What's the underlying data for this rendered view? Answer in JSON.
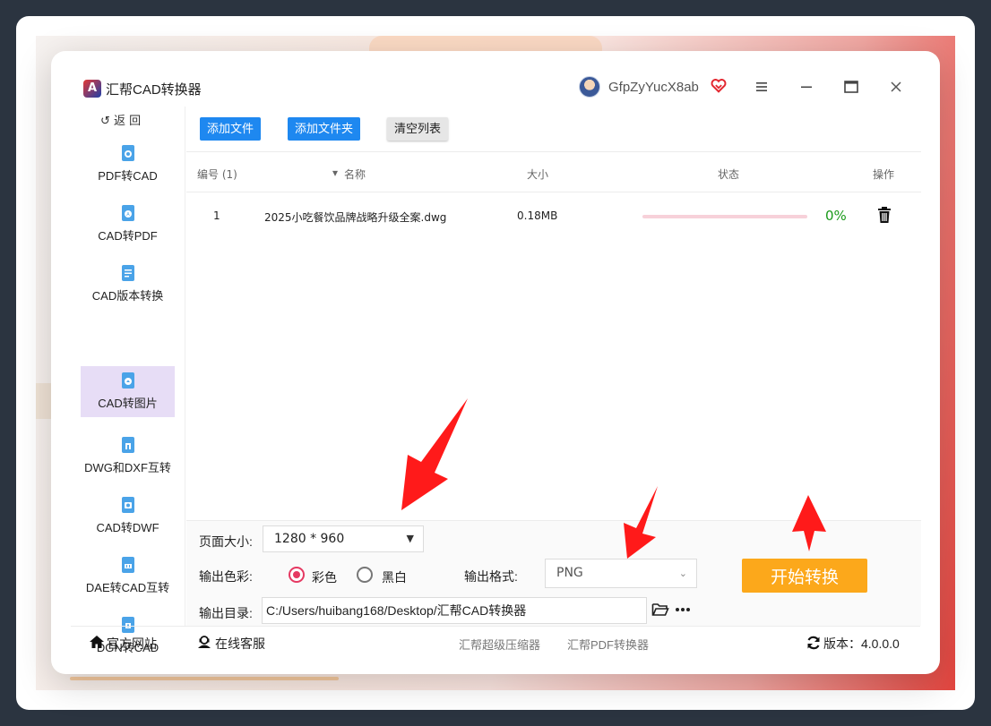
{
  "app": {
    "title": "汇帮CAD转换器",
    "username": "GfpZyYucX8ab",
    "accent": "#1e88f0",
    "start_color": "#fca81b"
  },
  "sidebar": {
    "back_label": "返 回",
    "items": [
      {
        "label": "PDF转CAD",
        "icon": "pdf-to-cad-icon"
      },
      {
        "label": "CAD转PDF",
        "icon": "cad-to-pdf-icon"
      },
      {
        "label": "CAD版本转换",
        "icon": "cad-version-icon"
      },
      {
        "label": "CAD转图片",
        "icon": "cad-to-image-icon",
        "active": true
      },
      {
        "label": "DWG和DXF互转",
        "icon": "dwg-dxf-icon"
      },
      {
        "label": "CAD转DWF",
        "icon": "cad-to-dwf-icon"
      },
      {
        "label": "DAE转CAD互转",
        "icon": "dae-cad-icon"
      },
      {
        "label": "DGN转CAD",
        "icon": "dgn-cad-icon"
      }
    ]
  },
  "toolbar": {
    "add_file": "添加文件",
    "add_folder": "添加文件夹",
    "clear_list": "清空列表"
  },
  "table": {
    "headers": {
      "index": "编号 (1)",
      "name": "名称",
      "size": "大小",
      "status": "状态",
      "action": "操作"
    },
    "rows": [
      {
        "index": "1",
        "name": "2025小吃餐饮品牌战略升级全案.dwg",
        "size": "0.18MB",
        "progress": "0%",
        "progress_value": 0
      }
    ]
  },
  "settings": {
    "page_size_label": "页面大小:",
    "page_size_value": "1280 * 960",
    "color_label": "输出色彩:",
    "color_option_color": "彩色",
    "color_option_bw": "黑白",
    "color_selected": "彩色",
    "format_label": "输出格式:",
    "format_value": "PNG",
    "dir_label": "输出目录:",
    "dir_value": "C:/Users/huibang168/Desktop/汇帮CAD转换器",
    "start_label": "开始转换"
  },
  "footer": {
    "official_site": "官方网站",
    "online_service": "在线客服",
    "compressor": "汇帮超级压缩器",
    "pdf_converter": "汇帮PDF转换器",
    "version": "版本：4.0.0.0"
  }
}
